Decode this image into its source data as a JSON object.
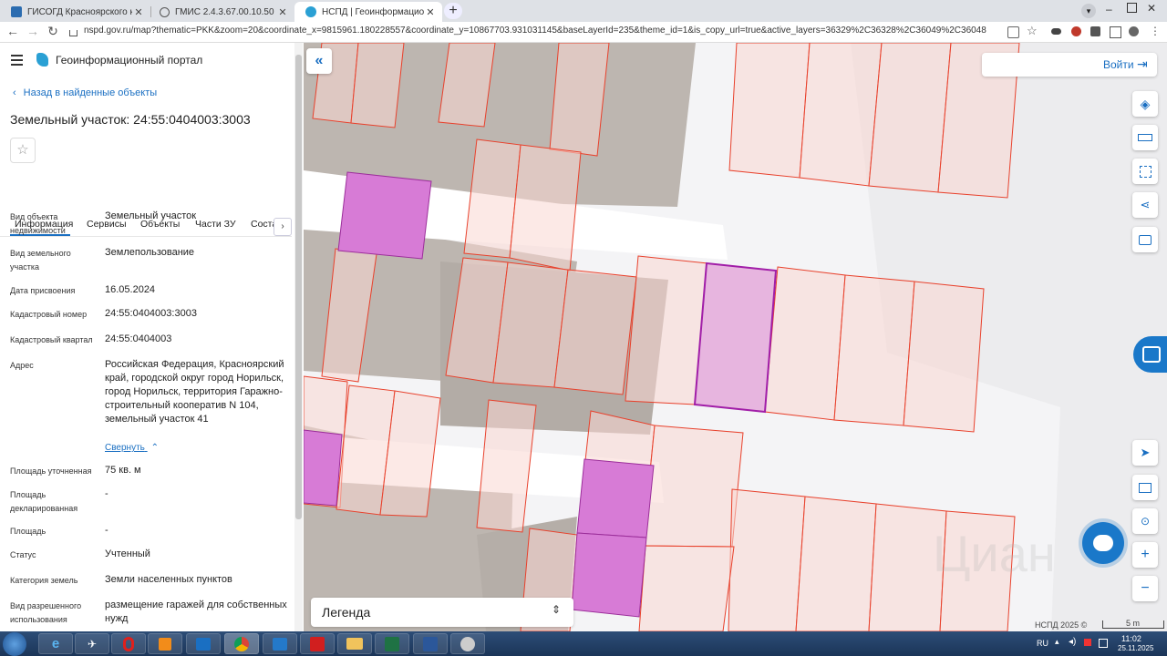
{
  "browser": {
    "tabs": [
      {
        "title": "ГИСОГД Красноярского края",
        "active": false
      },
      {
        "title": "ГМИС 2.4.3.67.00.10.50",
        "active": false
      },
      {
        "title": "НСПД | Геоинформационный п",
        "active": true
      }
    ],
    "new_tab": "+",
    "url": "nspd.gov.ru/map?thematic=PKK&zoom=20&coordinate_x=9815961.180228557&coordinate_y=10867703.931031145&baseLayerId=235&theme_id=1&is_copy_url=true&active_layers=36329%2C36328%2C36049%2C36048"
  },
  "app": {
    "title": "Геоинформационный портал",
    "back_link": "Назад в найденные объекты",
    "object_title": "Земельный участок: 24:55:0404003:3003",
    "tabs": [
      "Информация",
      "Сервисы",
      "Объекты",
      "Части ЗУ",
      "Соста"
    ],
    "collapse_link": "Свернуть",
    "fields": [
      {
        "label": "Вид объекта недвижимости",
        "value": "Земельный участок"
      },
      {
        "label": "Вид земельного участка",
        "value": "Землепользование"
      },
      {
        "label": "Дата присвоения",
        "value": "16.05.2024"
      },
      {
        "label": "Кадастровый номер",
        "value": "24:55:0404003:3003"
      },
      {
        "label": "Кадастровый квартал",
        "value": "24:55:0404003"
      },
      {
        "label": "Адрес",
        "value": "Российская Федерация, Красноярский край, городской округ город Норильск, город Норильск, территория Гаражно-строительный кооператив N 104, земельный участок 41"
      },
      {
        "label": "Площадь уточненная",
        "value": "75 кв. м"
      },
      {
        "label": "Площадь декларированная",
        "value": "-"
      },
      {
        "label": "Площадь",
        "value": "-"
      },
      {
        "label": "Статус",
        "value": "Учтенный"
      },
      {
        "label": "Категория земель",
        "value": "Земли населенных пунктов"
      },
      {
        "label": "Вид разрешенного использования",
        "value": "размещение гаражей для собственных нужд"
      }
    ]
  },
  "map": {
    "login": "Войти",
    "legend": "Легенда",
    "footer": "НСПД 2025 ©",
    "scale": "5 m",
    "watermark": "Циан",
    "colors": {
      "parcel_border": "#e8412c",
      "selected": "#d77bd6",
      "building": "#bdb6b0"
    }
  },
  "taskbar": {
    "lang": "RU",
    "time": "11:02",
    "date": "25.11.2025"
  }
}
